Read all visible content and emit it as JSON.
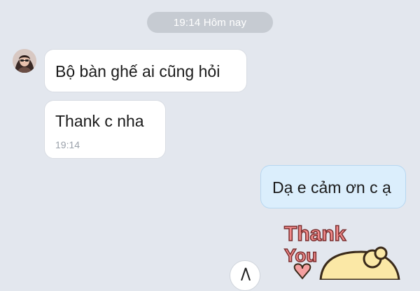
{
  "chat": {
    "time_divider": "19:14 Hôm nay",
    "messages": [
      {
        "sender": "contact",
        "text": "Bộ bàn ghế ai cũng hỏi"
      },
      {
        "sender": "contact",
        "text": "Thank c nha",
        "time": "19:14"
      },
      {
        "sender": "self",
        "text": "Dạ e cảm ơn c ạ"
      }
    ],
    "sticker": {
      "line1": "Thank",
      "line2": "You"
    }
  },
  "colors": {
    "background": "#e3e7ee",
    "incoming_bubble": "#ffffff",
    "outgoing_bubble": "#dbeefc",
    "outgoing_border": "#b6d7f1",
    "time_pill": "#c6cbd2",
    "sticker_text": "#f08a8a",
    "sticker_character": "#fbe8a6"
  },
  "icons": [
    "contact-avatar-icon",
    "thank-you-sticker-icon",
    "partial-icon"
  ]
}
